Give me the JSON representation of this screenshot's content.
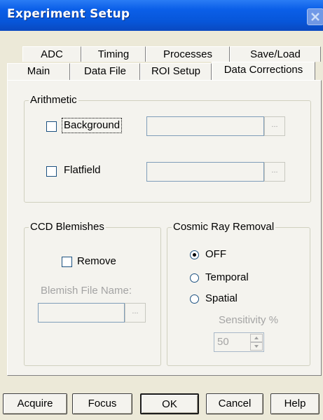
{
  "window": {
    "title": "Experiment Setup"
  },
  "tabs": {
    "row_back": [
      "ADC",
      "Timing",
      "Processes",
      "Save/Load"
    ],
    "row_front": [
      "Main",
      "Data File",
      "ROI Setup",
      "Data Corrections"
    ],
    "active": "Data Corrections"
  },
  "arithmetic": {
    "title": "Arithmetic",
    "background": {
      "label": "Background",
      "checked": false,
      "file": "",
      "browse": "..."
    },
    "flatfield": {
      "label": "Flatfield",
      "checked": false,
      "file": "",
      "browse": "..."
    }
  },
  "ccd_blemishes": {
    "title": "CCD Blemishes",
    "remove_label": "Remove",
    "remove_checked": false,
    "file_label": "Blemish File Name:",
    "file": "",
    "browse": "..."
  },
  "cosmic_ray": {
    "title": "Cosmic Ray Removal",
    "options": [
      "OFF",
      "Temporal",
      "Spatial"
    ],
    "selected": "OFF",
    "sensitivity_label": "Sensitivity %",
    "sensitivity_value": "50"
  },
  "buttons": {
    "acquire": "Acquire",
    "focus": "Focus",
    "ok": "OK",
    "cancel": "Cancel",
    "help": "Help"
  }
}
